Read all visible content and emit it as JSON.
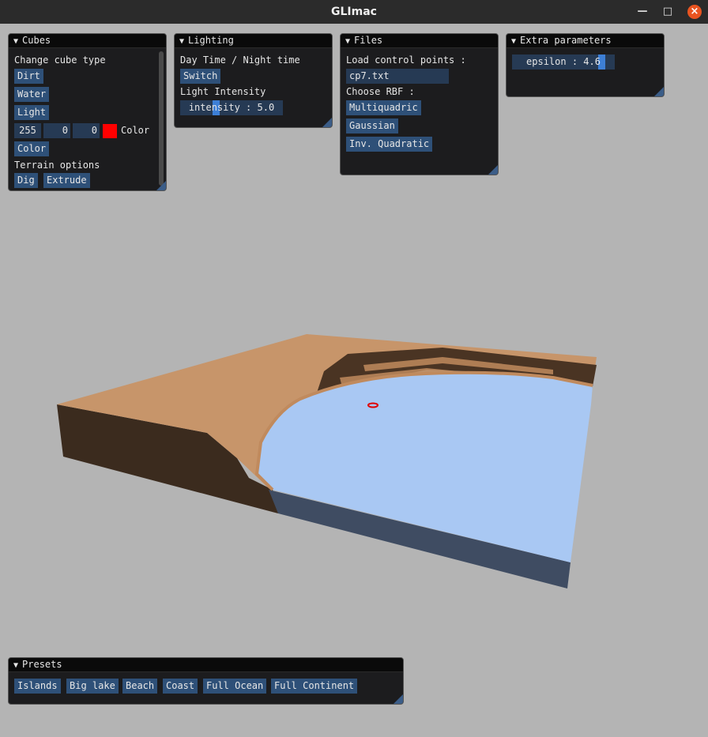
{
  "window": {
    "title": "GLImac"
  },
  "panels": {
    "cubes": {
      "title": "Cubes",
      "change_type_label": "Change cube type",
      "buttons": [
        "Dirt",
        "Water",
        "Light"
      ],
      "color_r": "255",
      "color_g": "0",
      "color_b": "0",
      "color_label": "Color",
      "swatch_color": "#ff0000",
      "color_button": "Color",
      "terrain_label": "Terrain options",
      "dig": "Dig",
      "extrude": "Extrude"
    },
    "lighting": {
      "title": "Lighting",
      "day_night_label": "Day Time / Night time",
      "switch": "Switch",
      "intensity_label": "Light Intensity",
      "intensity_slider": "intensity : 5.0",
      "intensity_value": 5.0
    },
    "files": {
      "title": "Files",
      "load_label": "Load control points :",
      "file_value": "cp7.txt",
      "rbf_label": "Choose RBF :",
      "rbf_options": [
        "Multiquadric",
        "Gaussian",
        "Inv. Quadratic"
      ]
    },
    "extra": {
      "title": "Extra parameters",
      "epsilon_slider": "epsilon : 4.6",
      "epsilon_value": 4.6
    },
    "presets": {
      "title": "Presets",
      "buttons": [
        "Islands",
        "Big lake",
        "Beach",
        "Coast",
        "Full Ocean",
        "Full Continent"
      ]
    }
  },
  "scene": {
    "sand": "#c9976a",
    "dirt": "#3b2b1e",
    "water_top": "#a9c8f2",
    "water_side": "#3e4b61",
    "cursor": "#e00000"
  }
}
